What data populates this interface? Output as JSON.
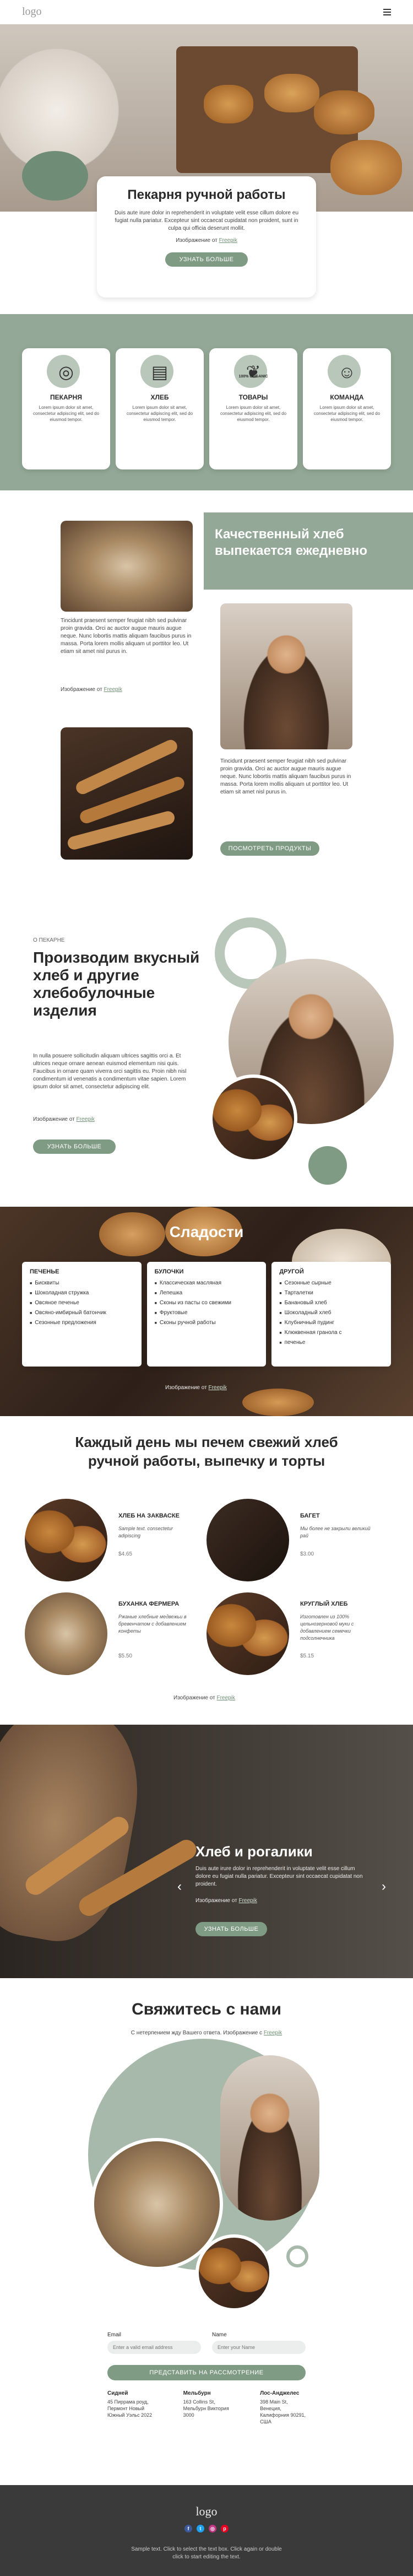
{
  "header": {
    "logo": "logo",
    "menu_icon": "hamburger-icon"
  },
  "hero": {
    "title": "Пекарня ручной работы",
    "text": "Duis aute irure dolor in reprehenderit in voluptate velit esse cillum dolore eu fugiat nulla pariatur. Excepteur sint occaecat cupidatat non proident, sunt in culpa qui officia deserunt mollit.",
    "credit_prefix": "Изображение от",
    "credit_link": "Freepik",
    "button": "УЗНАТЬ БОЛЬШЕ"
  },
  "features": [
    {
      "icon": "donut-icon",
      "title": "ПЕКАРНЯ",
      "text": "Lorem ipsum dolor sit amet, consectetur adipiscing elit, sed do eiusmod tempor."
    },
    {
      "icon": "bread-icon",
      "title": "ХЛЕБ",
      "text": "Lorem ipsum dolor sit amet, consectetur adipiscing elit, sed do eiusmod tempor."
    },
    {
      "icon": "organic-icon",
      "icon_text": "100% ORGANIC",
      "title": "ТОВАРЫ",
      "text": "Lorem ipsum dolor sit amet, consectetur adipiscing elit, sed do eiusmod tempor."
    },
    {
      "icon": "team-icon",
      "title": "КОМАНДА",
      "text": "Lorem ipsum dolor sit amet, consectetur adipiscing elit, sed do eiusmod tempor."
    }
  ],
  "quality": {
    "title": "Качественный хлеб выпекается ежедневно",
    "text1": "Tincidunt praesent semper feugiat nibh sed pulvinar proin gravida. Orci ac auctor augue mauris augue neque. Nunc lobortis mattis aliquam faucibus purus in massa. Porta lorem mollis aliquam ut porttitor leo. Ut etiam sit amet nisl purus in.",
    "credit_prefix": "Изображение от",
    "credit_link": "Freepik",
    "text2": "Tincidunt praesent semper feugiat nibh sed pulvinar proin gravida. Orci ac auctor augue mauris augue neque. Nunc lobortis mattis aliquam faucibus purus in massa. Porta lorem mollis aliquam ut porttitor leo. Ut etiam sit amet nisl purus in.",
    "button": "ПОСМОТРЕТЬ ПРОДУКТЫ"
  },
  "about": {
    "kicker": "О ПЕКАРНЕ",
    "title": "Производим вкусный хлеб и другие хлебобулочные изделия",
    "text": "In nulla posuere sollicitudin aliquam ultrices sagittis orci a. Et ultrices neque ornare aenean euismod elementum nisi quis. Faucibus in ornare quam viverra orci sagittis eu. Proin nibh nisl condimentum id venenatis a condimentum vitae sapien. Lorem ipsum dolor sit amet, consectetur adipiscing elit.",
    "credit_prefix": "Изображение от",
    "credit_link": "Freepik",
    "button": "УЗНАТЬ БОЛЬШЕ"
  },
  "sweets": {
    "title": "Сладости",
    "columns": [
      {
        "title": "ПЕЧЕНЬЕ",
        "items": [
          "Бисквиты",
          "Шоколадная стружка",
          "Овсяное печенье",
          "Овсяно-имбирный батончик",
          "Сезонные предложения"
        ]
      },
      {
        "title": "БУЛОЧКИ",
        "items": [
          "Классическая масляная",
          "Лепешка",
          "Сконы из пасты со свежими",
          "Фруктовые",
          "Сконы ручной работы"
        ]
      },
      {
        "title": "ДРУГОЙ",
        "items": [
          "Сезонные сырные",
          "Тарталетки",
          "Банановый хлеб",
          "Шоколадный хлеб",
          "Клубничный пудинг",
          "Клюквенная гранола с",
          "печенье"
        ]
      }
    ],
    "credit_prefix": "Изображение от",
    "credit_link": "Freepik"
  },
  "products": {
    "title": "Каждый день мы печем свежий хлеб ручной работы, выпечку и торты",
    "items": [
      {
        "name": "ХЛЕБ НА ЗАКВАСКЕ",
        "desc": "Sample text. consectetur adipiscing",
        "price": "$4.65"
      },
      {
        "name": "БАГЕТ",
        "desc": "Мы более не закрыли великий рай",
        "price": "$3.00"
      },
      {
        "name": "БУХАНКА ФЕРМЕРА",
        "desc": "Ржаные хлебные медвежьи в бревенчатом с добавлением конфеты",
        "price": "$5.50"
      },
      {
        "name": "КРУГЛЫЙ ХЛЕБ",
        "desc": "Изготовлен из 100% цельнозерновой муки с добавлением семечки подсолнечника",
        "price": "$5.15"
      }
    ],
    "credit_prefix": "Изображение от",
    "credit_link": "Freepik"
  },
  "slider": {
    "title": "Хлеб и рогалики",
    "text": "Duis aute irure dolor in reprehenderit in voluptate velit esse cillum dolore eu fugiat nulla pariatur. Excepteur sint occaecat cupidatat non proident.",
    "credit_prefix": "Изображение от",
    "credit_link": "Freepik",
    "button": "УЗНАТЬ БОЛЬШЕ",
    "prev": "‹",
    "next": "›"
  },
  "contact": {
    "title": "Свяжитесь с нами",
    "subtitle": "С нетерпением жду Вашего ответа. Изображение с",
    "subtitle_link": "Freepik",
    "email_label": "Email",
    "email_placeholder": "Enter a valid email address",
    "name_label": "Name",
    "name_placeholder": "Enter your Name",
    "submit": "ПРЕДСТАВИТЬ НА РАССМОТРЕНИЕ",
    "offices": [
      {
        "city": "Сидней",
        "lines": [
          "45 Пиррама роуд,",
          "Пермонт Новый",
          "Южный Уэльс 2022"
        ]
      },
      {
        "city": "Мельбурн",
        "lines": [
          "163 Collins St,",
          "Мельбурн Виктория",
          "3000"
        ]
      },
      {
        "city": "Лос-Анджелес",
        "lines": [
          "398 Main St,",
          "Венеция,",
          "Калифорния 90291,",
          "США"
        ]
      }
    ]
  },
  "footer": {
    "logo": "logo",
    "social": [
      "facebook-icon",
      "twitter-icon",
      "instagram-icon",
      "pinterest-icon"
    ],
    "line1": "Sample text. Click to select the text box. Click again or double",
    "line2": "click to start editing the text."
  }
}
